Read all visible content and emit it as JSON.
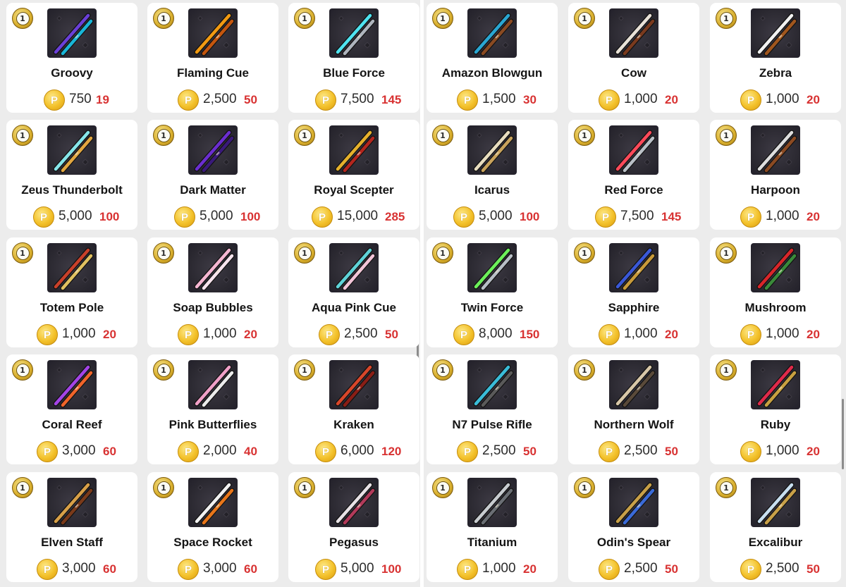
{
  "badge_label": "1",
  "coin_symbol": "P",
  "colors": {
    "points": "#d83232",
    "coin": "#f3c12a",
    "thumb_bg": "#2a2830"
  },
  "cues": [
    {
      "name": "Groovy",
      "price": "750",
      "points": "19",
      "colors": [
        "#6a3fd8",
        "#19b6d8"
      ]
    },
    {
      "name": "Flaming Cue",
      "price": "2,500",
      "points": "50",
      "colors": [
        "#f29a12",
        "#c4560e"
      ]
    },
    {
      "name": "Blue Force",
      "price": "7,500",
      "points": "145",
      "colors": [
        "#4fe3f0",
        "#aeb4bd"
      ]
    },
    {
      "name": "Amazon Blowgun",
      "price": "1,500",
      "points": "30",
      "colors": [
        "#2aa6d2",
        "#8a4a22"
      ]
    },
    {
      "name": "Cow",
      "price": "1,000",
      "points": "20",
      "colors": [
        "#e9e2d8",
        "#7a3a1e"
      ]
    },
    {
      "name": "Zebra",
      "price": "1,000",
      "points": "20",
      "colors": [
        "#f2f2f2",
        "#a0561e"
      ]
    },
    {
      "name": "Zeus Thunderbolt",
      "price": "5,000",
      "points": "100",
      "colors": [
        "#86e6ea",
        "#e2a640"
      ]
    },
    {
      "name": "Dark Matter",
      "price": "5,000",
      "points": "100",
      "colors": [
        "#6b2ed0",
        "#3a1a7a"
      ]
    },
    {
      "name": "Royal Scepter",
      "price": "15,000",
      "points": "285",
      "colors": [
        "#e6b12c",
        "#b3261e"
      ]
    },
    {
      "name": "Icarus",
      "price": "5,000",
      "points": "100",
      "colors": [
        "#e8ddbf",
        "#c9a35c"
      ]
    },
    {
      "name": "Red Force",
      "price": "7,500",
      "points": "145",
      "colors": [
        "#ff4a5a",
        "#b9bfc6"
      ]
    },
    {
      "name": "Harpoon",
      "price": "1,000",
      "points": "20",
      "colors": [
        "#dedede",
        "#8b4a22"
      ]
    },
    {
      "name": "Totem Pole",
      "price": "1,000",
      "points": "20",
      "colors": [
        "#c8402a",
        "#e0c060"
      ]
    },
    {
      "name": "Soap Bubbles",
      "price": "1,000",
      "points": "20",
      "colors": [
        "#f5b6d2",
        "#f7e4ee"
      ]
    },
    {
      "name": "Aqua Pink Cue",
      "price": "2,500",
      "points": "50",
      "colors": [
        "#5fd3d8",
        "#f2c4d8"
      ]
    },
    {
      "name": "Twin Force",
      "price": "8,000",
      "points": "150",
      "colors": [
        "#6cf05a",
        "#b8bec6"
      ]
    },
    {
      "name": "Sapphire",
      "price": "1,000",
      "points": "20",
      "colors": [
        "#3a58d8",
        "#c89a3a"
      ]
    },
    {
      "name": "Mushroom",
      "price": "1,000",
      "points": "20",
      "colors": [
        "#d8262a",
        "#3a8a3a"
      ]
    },
    {
      "name": "Coral Reef",
      "price": "3,000",
      "points": "60",
      "colors": [
        "#a344e6",
        "#f0642a"
      ]
    },
    {
      "name": "Pink Butterflies",
      "price": "2,000",
      "points": "40",
      "colors": [
        "#f0a0c8",
        "#ececec"
      ]
    },
    {
      "name": "Kraken",
      "price": "6,000",
      "points": "120",
      "colors": [
        "#d8462a",
        "#8a1e16"
      ]
    },
    {
      "name": "N7 Pulse Rifle",
      "price": "2,500",
      "points": "50",
      "colors": [
        "#3abcd8",
        "#5a5a5a"
      ]
    },
    {
      "name": "Northern Wolf",
      "price": "2,500",
      "points": "50",
      "colors": [
        "#d8c7a8",
        "#5a4a3a"
      ]
    },
    {
      "name": "Ruby",
      "price": "1,000",
      "points": "20",
      "colors": [
        "#e02a4a",
        "#c8a040"
      ]
    },
    {
      "name": "Elven Staff",
      "price": "3,000",
      "points": "60",
      "colors": [
        "#d8a048",
        "#7a3a1a"
      ]
    },
    {
      "name": "Space Rocket",
      "price": "3,000",
      "points": "60",
      "colors": [
        "#f2f2f2",
        "#e8761a"
      ]
    },
    {
      "name": "Pegasus",
      "price": "5,000",
      "points": "100",
      "colors": [
        "#e8e2e6",
        "#b23a5a"
      ]
    },
    {
      "name": "Titanium",
      "price": "1,000",
      "points": "20",
      "colors": [
        "#c8ccd0",
        "#6a6e74"
      ]
    },
    {
      "name": "Odin's Spear",
      "price": "2,500",
      "points": "50",
      "colors": [
        "#c8a048",
        "#3a6ad8"
      ]
    },
    {
      "name": "Excalibur",
      "price": "2,500",
      "points": "50",
      "colors": [
        "#c8dff0",
        "#c8a048"
      ]
    }
  ]
}
